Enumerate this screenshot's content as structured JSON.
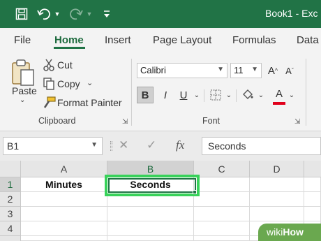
{
  "title_bar": {
    "document_title": "Book1  -  Exc",
    "icons": [
      "save-icon",
      "undo-icon",
      "redo-icon",
      "customize-quick-access-icon"
    ]
  },
  "ribbon_tabs": {
    "items": [
      {
        "label": "File"
      },
      {
        "label": "Home"
      },
      {
        "label": "Insert"
      },
      {
        "label": "Page Layout"
      },
      {
        "label": "Formulas"
      },
      {
        "label": "Data"
      }
    ],
    "active": "Home"
  },
  "clipboard": {
    "paste_label": "Paste",
    "cut_label": "Cut",
    "copy_label": "Copy",
    "format_painter_label": "Format Painter",
    "group_label": "Clipboard"
  },
  "font": {
    "font_name": "Calibri",
    "font_size": "11",
    "group_label": "Font",
    "bold_label": "B",
    "italic_label": "I",
    "underline_label": "U",
    "font_color_label": "A",
    "font_color": "#e0001b"
  },
  "formula_bar": {
    "name_box": "B1",
    "fx_label": "fx",
    "content": "Seconds"
  },
  "sheet": {
    "columns": [
      "A",
      "B",
      "C",
      "D"
    ],
    "rows": [
      "1",
      "2",
      "3",
      "4"
    ],
    "cells": {
      "A1": "Minutes",
      "B1": "Seconds"
    },
    "selected_cell": "B1"
  },
  "watermark": {
    "wiki": "wiki",
    "how": "How"
  },
  "colors": {
    "excel_green": "#217346",
    "highlight": "#38d25a"
  }
}
